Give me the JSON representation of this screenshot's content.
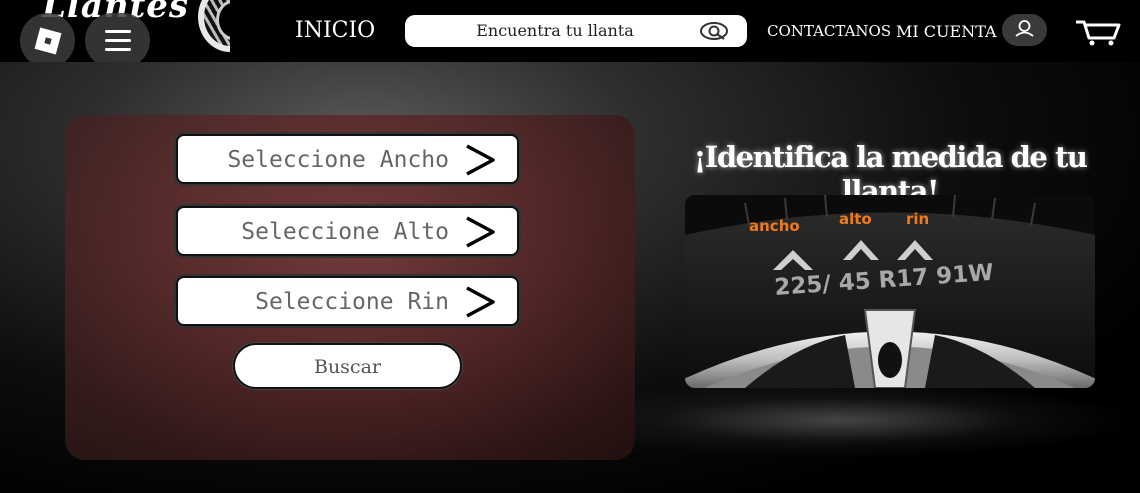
{
  "header": {
    "logo_text": "Llantes",
    "nav_inicio": "INICIO",
    "search_placeholder": "Encuentra tu llanta",
    "nav_contact": "CONTACTANOS",
    "nav_account": "MI CUENTA"
  },
  "form": {
    "ancho_label": "Seleccione Ancho",
    "alto_label": "Seleccione Alto",
    "rin_label": "Seleccione Rin",
    "search_button": "Buscar"
  },
  "info": {
    "headline": "¡Identifica la medida de tu llanta!",
    "tire_labels": {
      "ancho": "ancho",
      "alto": "alto",
      "rin": "rin",
      "size_code": "225/ 45 R17 91W"
    },
    "accent_color": "#f07a1a"
  }
}
